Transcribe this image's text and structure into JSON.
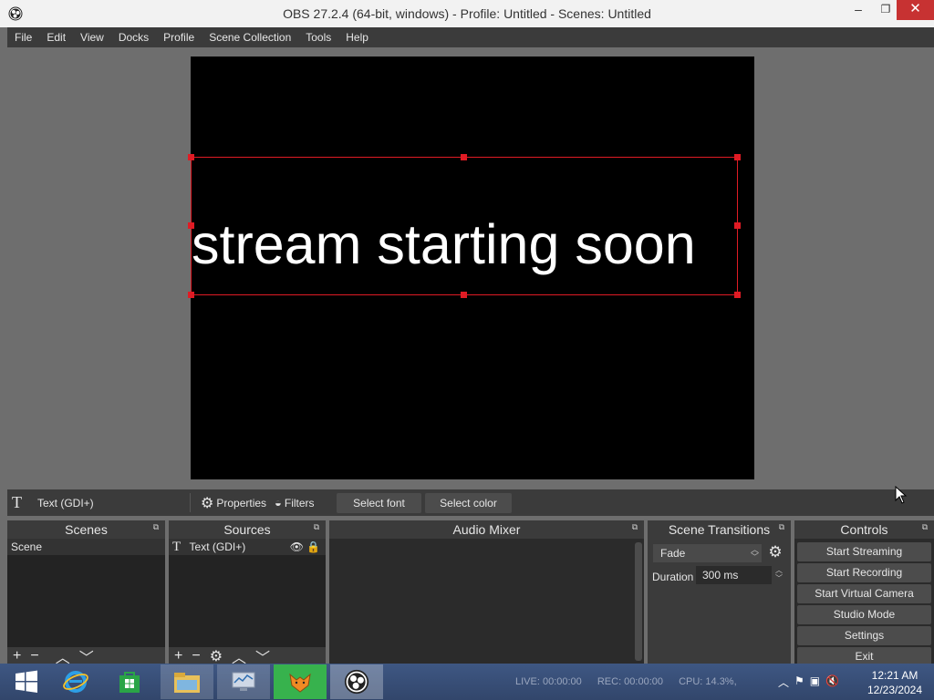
{
  "window": {
    "title": "OBS 27.2.4 (64-bit, windows) - Profile: Untitled - Scenes: Untitled",
    "minimize": "–",
    "maximize": "❐",
    "close": "✕"
  },
  "menu": [
    "File",
    "Edit",
    "View",
    "Docks",
    "Profile",
    "Scene Collection",
    "Tools",
    "Help"
  ],
  "preview": {
    "text": "stream starting soon"
  },
  "source_toolbar": {
    "source_icon": "T",
    "source_name": "Text (GDI+)",
    "properties": "Properties",
    "filters": "Filters",
    "select_font": "Select font",
    "select_color": "Select color"
  },
  "scenes": {
    "title": "Scenes",
    "items": [
      "Scene"
    ]
  },
  "sources": {
    "title": "Sources",
    "items": [
      {
        "name": "Text (GDI+)"
      }
    ]
  },
  "mixer": {
    "title": "Audio Mixer"
  },
  "transitions": {
    "title": "Scene Transitions",
    "selected": "Fade",
    "duration_label": "Duration",
    "duration_value": "300 ms"
  },
  "controls": {
    "title": "Controls",
    "buttons": [
      "Start Streaming",
      "Start Recording",
      "Start Virtual Camera",
      "Studio Mode",
      "Settings",
      "Exit"
    ]
  },
  "status": {
    "live": "LIVE: 00:00:00",
    "rec": "REC: 00:00:00",
    "cpu": "CPU: 14.3%,"
  },
  "clock": {
    "time": "12:21 AM",
    "date": "12/23/2024"
  },
  "colors": {
    "selection": "#e01b24",
    "panel": "#3b3b3b",
    "close_button": "#c73232"
  }
}
